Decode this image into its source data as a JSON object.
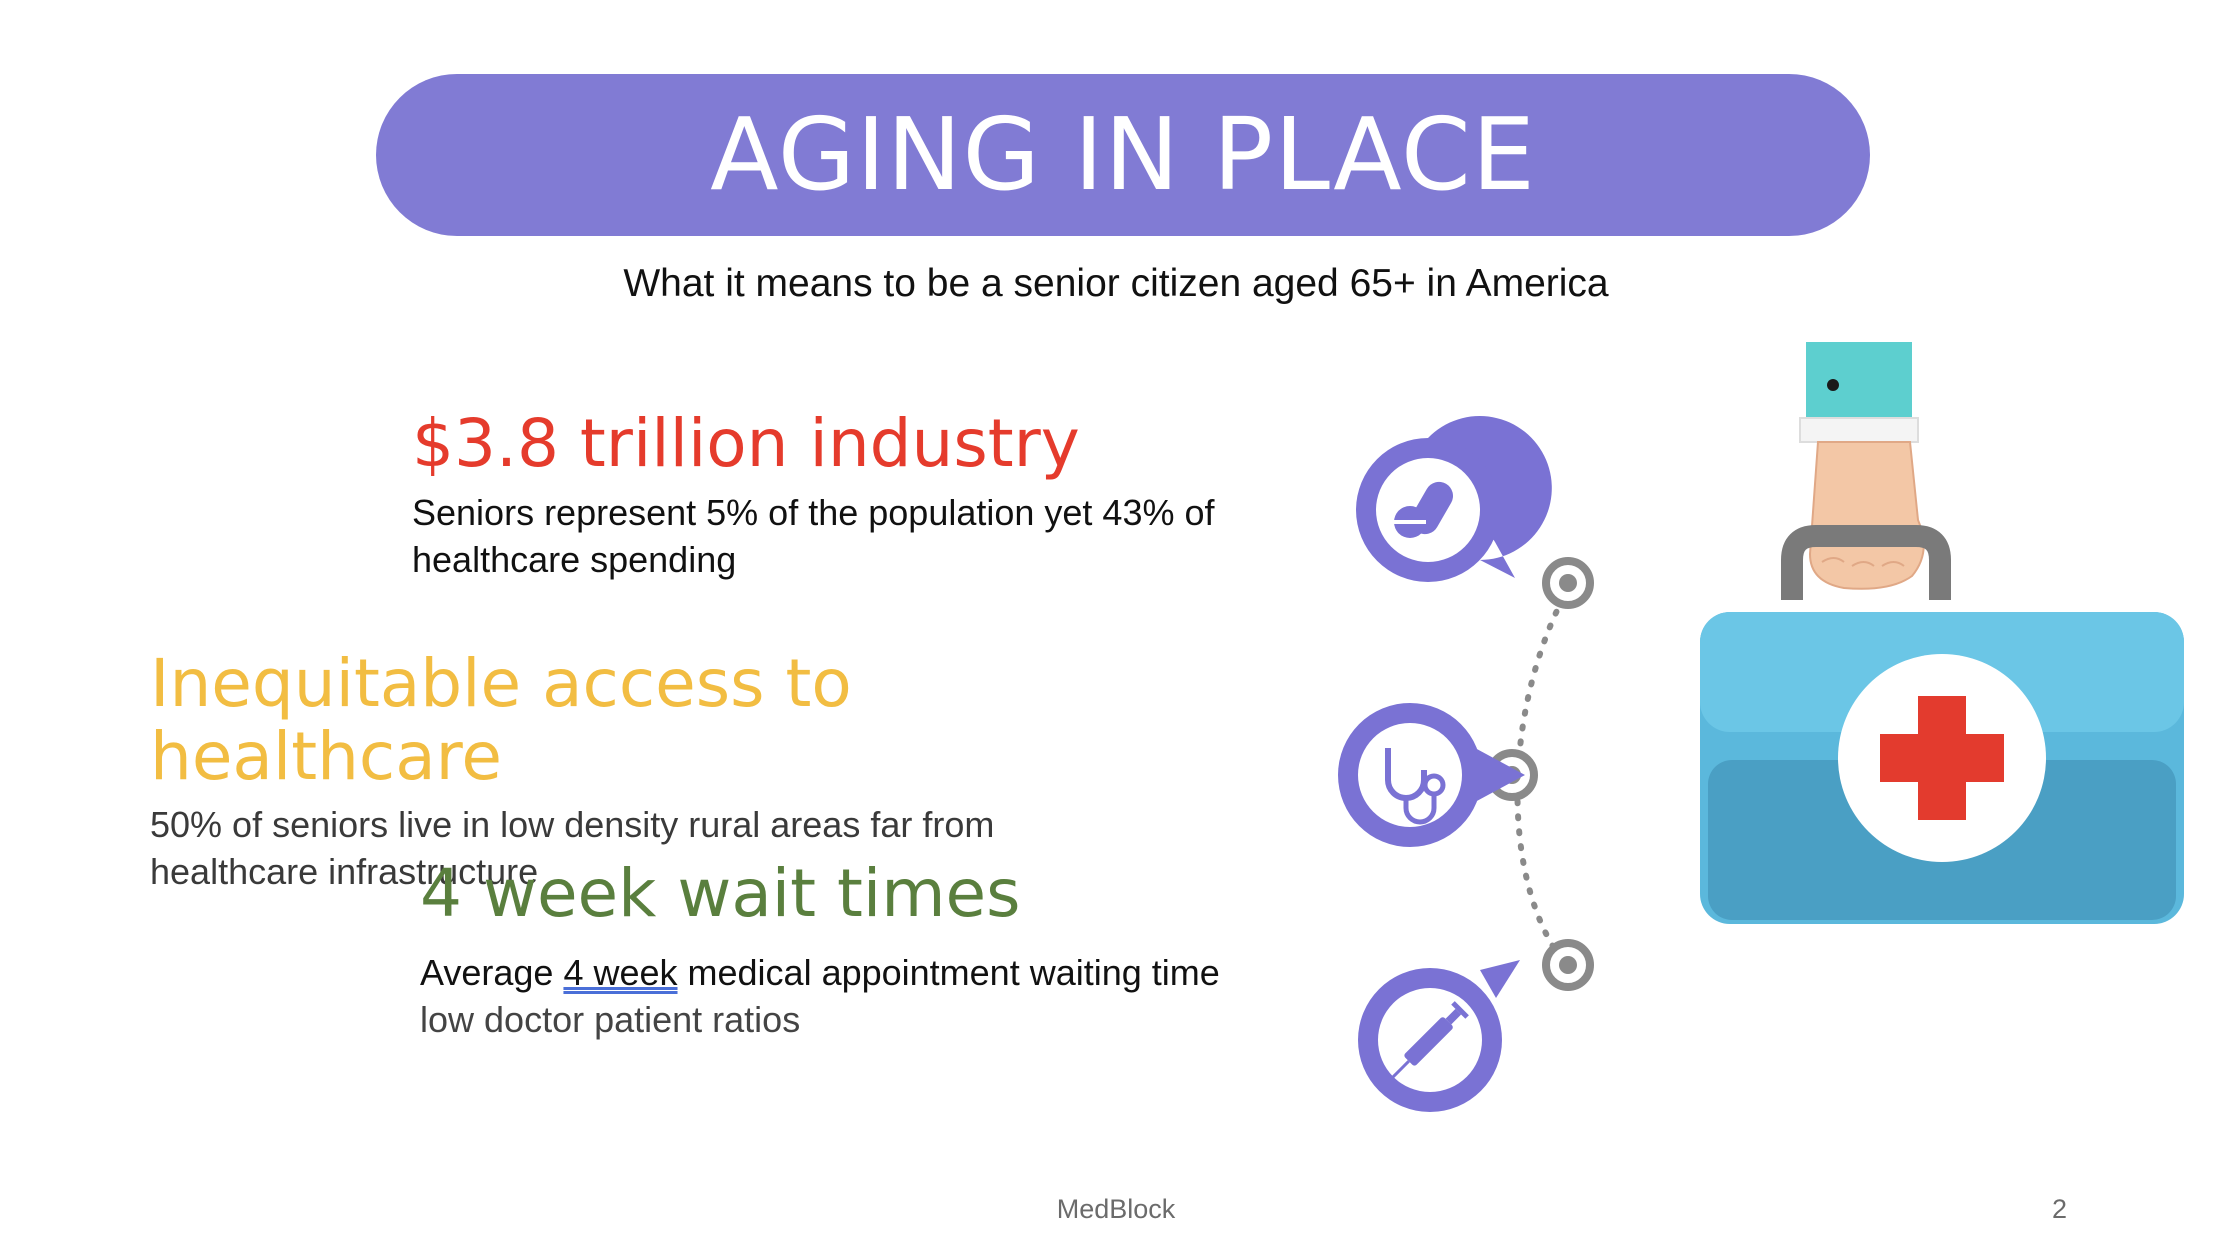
{
  "slide": {
    "title": "AGING IN PLACE",
    "subtitle": "What it means to be a senior citizen aged 65+ in America",
    "points": [
      {
        "heading": "$3.8 trillion industry",
        "body": "Seniors represent 5% of the population yet 43% of healthcare spending",
        "color": "#e53b2c"
      },
      {
        "heading": "Inequitable access to healthcare",
        "body": "50% of seniors live in low density rural areas far from healthcare infrastructure",
        "color": "#f2bd42"
      },
      {
        "heading": "4 week wait times",
        "body_prefix": "Average ",
        "body_underlined": "4 week",
        "body_middle": " medical appointment waiting time",
        "body_suffix": " low doctor patient ratios",
        "color": "#5a7f3e"
      }
    ],
    "illustration": {
      "icons": [
        "pills-icon",
        "stethoscope-icon",
        "syringe-icon"
      ],
      "main": "medical-bag-icon",
      "accent": "#7a72d4",
      "bag_color": "#5bb8dc",
      "cross_color": "#e33b2e"
    },
    "footer": {
      "brand": "MedBlock",
      "page": "2"
    },
    "colors": {
      "title_bg": "#817bd4",
      "title_text": "#ffffff"
    }
  }
}
